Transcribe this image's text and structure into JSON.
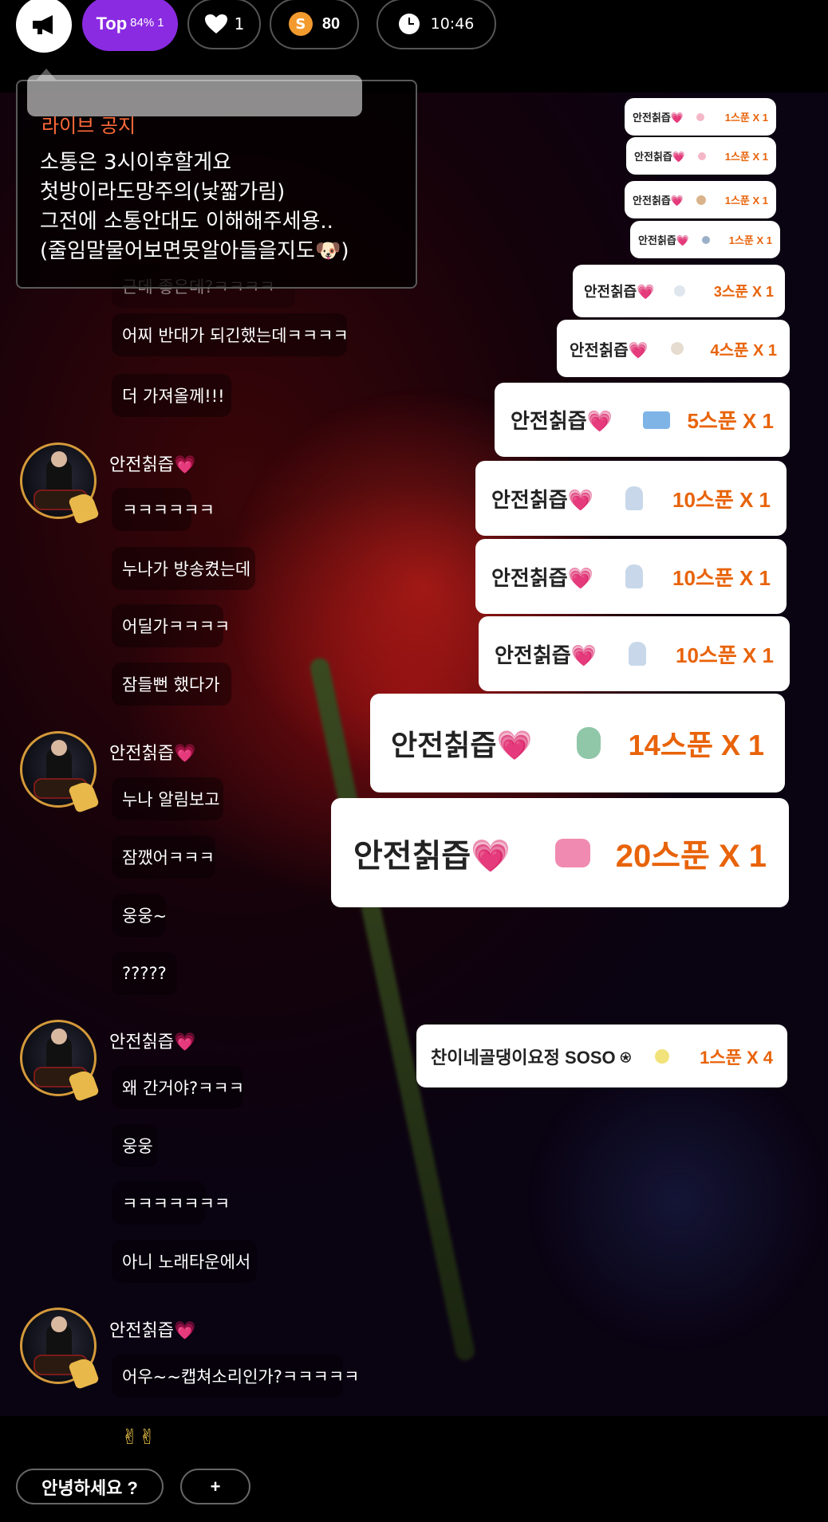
{
  "topbar": {
    "top_label": "Top",
    "top_percent": "84%",
    "top_rank": "1",
    "likes_count": "1",
    "coin_symbol": "S",
    "coin_count": "80",
    "time": "10:46"
  },
  "notice": {
    "title": "라이브 공지",
    "body": "소통은 3시이후할게요\n첫방이라도망주의(낯짧가림)\n그전에 소통안대도 이해해주세용..\n(줄임말물어보면못알아들을지도🐶)",
    "hidden_line": "근데 좋은데?ㅋㅋㅋㅋ"
  },
  "chat": {
    "messages_top": [
      "어찌 반대가 되긴했는데ㅋㅋㅋㅋ",
      "더 가져올께!!!"
    ],
    "group1": {
      "username": "안전칡즙💗",
      "messages": [
        "ㅋㅋㅋㅋㅋㅋ",
        "누나가 방송켰는데",
        "어딜가ㅋㅋㅋㅋ",
        "잠들뻔 했다가"
      ]
    },
    "group2": {
      "username": "안전칡즙💗",
      "messages": [
        "누나 알림보고",
        "잠깼어ㅋㅋㅋ",
        "웅웅~",
        "?????"
      ]
    },
    "group3": {
      "username": "안전칡즙💗",
      "messages": [
        "왜 간거야?ㅋㅋㅋ",
        "웅웅",
        "ㅋㅋㅋㅋㅋㅋㅋ",
        "아니 노래타운에서"
      ]
    },
    "group4": {
      "username": "안전칡즙💗",
      "messages": [
        "어우~~캡쳐소리인가?ㅋㅋㅋㅋㅋ"
      ]
    },
    "last_emoji": "✌✌"
  },
  "gifts": [
    {
      "name": "안전칡즙💗",
      "amount": "1스푼 X 1"
    },
    {
      "name": "안전칡즙💗",
      "amount": "1스푼 X 1"
    },
    {
      "name": "안전칡즙💗",
      "amount": "1스푼 X 1"
    },
    {
      "name": "안전칡즙💗",
      "amount": "1스푼 X 1"
    },
    {
      "name": "안전칡즙💗",
      "amount": "3스푼 X 1"
    },
    {
      "name": "안전칡즙💗",
      "amount": "4스푼 X 1"
    },
    {
      "name": "안전칡즙💗",
      "amount": "5스푼 X 1"
    },
    {
      "name": "안전칡즙💗",
      "amount": "10스푼 X 1"
    },
    {
      "name": "안전칡즙💗",
      "amount": "10스푼 X 1"
    },
    {
      "name": "안전칡즙💗",
      "amount": "10스푼 X 1"
    },
    {
      "name": "안전칡즙💗",
      "amount": "14스푼 X 1"
    },
    {
      "name": "안전칡즙💗",
      "amount": "20스푼 X 1"
    },
    {
      "name": "찬이네골댕이요정 SOSO ⍟",
      "amount": "1스푼 X 4"
    }
  ],
  "ghost_gift": {
    "name": "안전칡즙💗",
    "amount": "20스푼"
  },
  "bottom": {
    "greeting_button": "안녕하세요 ?",
    "plus_button": "+"
  },
  "colors": {
    "accent_purple": "#8a2be2",
    "gift_amount_orange": "#e8630a",
    "notice_title": "#ff6a3a",
    "coin": "#f29a2e"
  }
}
